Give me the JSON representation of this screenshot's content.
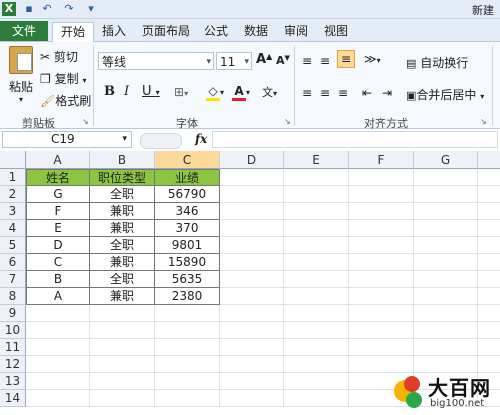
{
  "window": {
    "title": "新建"
  },
  "tabs": [
    "文件",
    "开始",
    "插入",
    "页面布局",
    "公式",
    "数据",
    "审阅",
    "视图"
  ],
  "ribbon": {
    "clipboard": {
      "paste": "粘贴",
      "cut": "剪切",
      "copy": "复制",
      "format_painter": "格式刷",
      "group_label": "剪贴板"
    },
    "font": {
      "name": "等线",
      "size": "11",
      "group_label": "字体",
      "bold": "B",
      "italic": "I",
      "underline": "U",
      "font_color_glyph": "A",
      "grow_glyph": "A",
      "shrink_glyph": "A"
    },
    "alignment": {
      "wrap": "自动换行",
      "merge": "合并后居中",
      "group_label": "对齐方式"
    }
  },
  "formula_bar": {
    "name_box": "C19",
    "fx": "fx"
  },
  "columns": [
    "A",
    "B",
    "C",
    "D",
    "E",
    "F",
    "G"
  ],
  "rows": [
    "1",
    "2",
    "3",
    "4",
    "5",
    "6",
    "7",
    "8",
    "9",
    "10",
    "11",
    "12",
    "13",
    "14"
  ],
  "table": {
    "headers": [
      "姓名",
      "职位类型",
      "业绩"
    ],
    "rows": [
      [
        "G",
        "全职",
        "56790"
      ],
      [
        "F",
        "兼职",
        "346"
      ],
      [
        "E",
        "兼职",
        "370"
      ],
      [
        "D",
        "全职",
        "9801"
      ],
      [
        "C",
        "兼职",
        "15890"
      ],
      [
        "B",
        "全职",
        "5635"
      ],
      [
        "A",
        "兼职",
        "2380"
      ]
    ]
  },
  "watermark": {
    "name": "大百网",
    "url": "big100.net"
  },
  "colors": {
    "header_fill": "#8cc641",
    "file_tab": "#2d7d3a",
    "selected_col": "#fcd89a"
  }
}
